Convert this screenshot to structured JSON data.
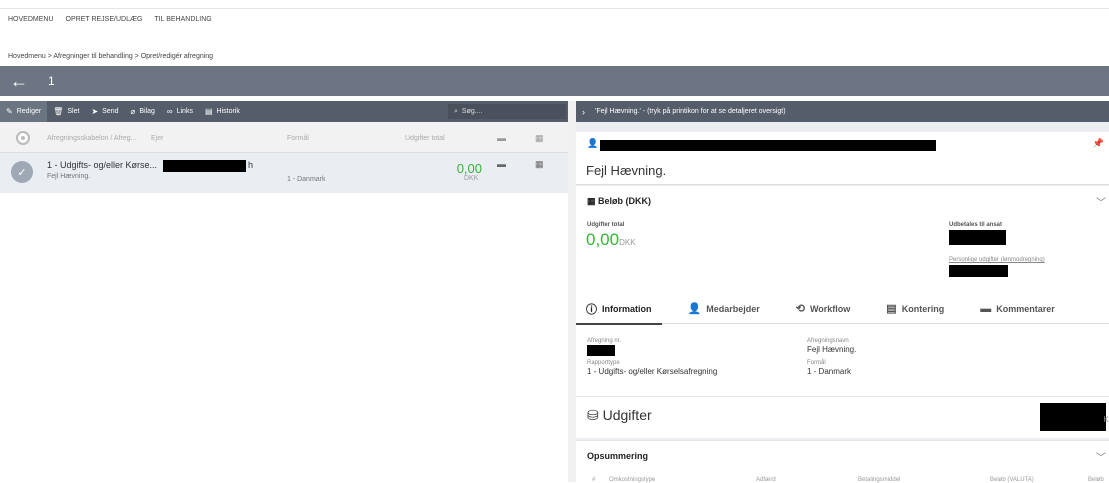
{
  "top_menu": [
    "HOVEDMENU",
    "OPRET REJSE/UDLÆG",
    "TIL BEHANDLING"
  ],
  "breadcrumb": "Hovedmenu  >  Afregninger til behandling  >  Opret/redigér afregning",
  "title_bar": {
    "back_icon": "←",
    "number": "1"
  },
  "toolbar": {
    "edit": "Rediger",
    "delete": "Slet",
    "send": "Send",
    "attachment": "Bilag",
    "links": "Links",
    "history": "Historik",
    "search_placeholder": "Søg...."
  },
  "list_header": {
    "template": "Afregningsskabelon / Afreg...",
    "owner": "Ejer",
    "purpose": "Formål",
    "total": "Udgifter total"
  },
  "list_row": {
    "title_prefix": "1 - Udgifts- og/eller Kørse...",
    "title_suffix": "h",
    "subtitle": "Fejl Hævning.",
    "purpose": "1 - Danmark",
    "amount": "0,00",
    "currency": "DKK"
  },
  "right_header": {
    "text": "'Fejl Hævning.' - (tryk på printikon for at se detaljeret oversigt)"
  },
  "detail": {
    "heading": "Fejl Hævning.",
    "amount_section": "Beløb (DKK)",
    "total_label": "Udgifter total",
    "total_amount": "0,00",
    "total_currency": "DKK",
    "payout_label": "Udbetales til ansat",
    "personal_label": "Personlige udgifter (lønmodregning)"
  },
  "tabs": [
    "Information",
    "Medarbejder",
    "Workflow",
    "Kontering",
    "Kommentarer"
  ],
  "info": {
    "settlement_nr_label": "Afregning nr.",
    "settlement_name_label": "Afregningsnavn",
    "settlement_name": "Fejl Hævning.",
    "report_type_label": "Rapporttype",
    "report_type": "1 - Udgifts- og/eller Kørselsafregning",
    "purpose_label": "Formål",
    "purpose": "1 - Danmark"
  },
  "expenses": {
    "title": "Udgifter",
    "suffix": "K"
  },
  "summary": {
    "title": "Opsummering",
    "columns": [
      "#",
      "Omkostningstype",
      "Adfærd",
      "Betalingsmiddel",
      "Beløb (VALUTA)",
      "Beløb"
    ]
  },
  "colors": {
    "accent_green": "#35b535",
    "toolbar": "#555d6a",
    "titlebar": "#6d7584"
  }
}
